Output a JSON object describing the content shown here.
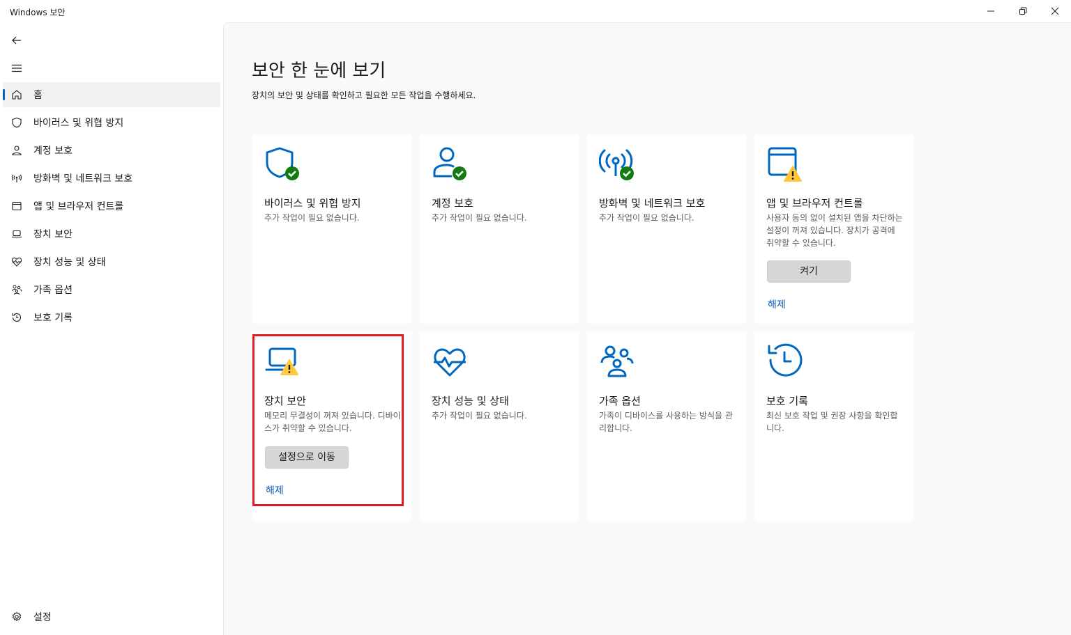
{
  "window": {
    "title": "Windows 보안",
    "minimize_glyph": "—",
    "maximize_glyph": "❐",
    "close_glyph": "✕"
  },
  "sidebar": {
    "items": [
      {
        "label": "홈",
        "icon": "home-icon",
        "active": true
      },
      {
        "label": "바이러스 및 위협 방지",
        "icon": "shield-icon"
      },
      {
        "label": "계정 보호",
        "icon": "person-icon"
      },
      {
        "label": "방화벽 및 네트워크 보호",
        "icon": "antenna-icon"
      },
      {
        "label": "앱 및 브라우저 컨트롤",
        "icon": "browser-window-icon"
      },
      {
        "label": "장치 보안",
        "icon": "laptop-icon"
      },
      {
        "label": "장치 성능 및 상태",
        "icon": "heart-pulse-icon"
      },
      {
        "label": "가족 옵션",
        "icon": "family-icon"
      },
      {
        "label": "보호 기록",
        "icon": "history-icon"
      }
    ],
    "settings_label": "설정"
  },
  "main": {
    "title": "보안 한 눈에 보기",
    "subtitle": "장치의 보안 및 상태를 확인하고 필요한 모든 작업을 수행하세요.",
    "cards": [
      {
        "title": "바이러스 및 위협 방지",
        "desc": "추가 작업이 필요 없습니다.",
        "icon": "shield-check-icon"
      },
      {
        "title": "계정 보호",
        "desc": "추가 작업이 필요 없습니다.",
        "icon": "person-check-icon"
      },
      {
        "title": "방화벽 및 네트워크 보호",
        "desc": "추가 작업이 필요 없습니다.",
        "icon": "antenna-check-icon"
      },
      {
        "title": "앱 및 브라우저 컨트롤",
        "desc": "사용자 동의 없이 설치된 앱을 차단하는 설정이 꺼져 있습니다. 장치가 공격에 취약할 수 있습니다.",
        "icon": "browser-warning-icon",
        "button": "켜기",
        "link": "해제"
      },
      {
        "title": "장치 보안",
        "desc": "메모리 무결성이 꺼져 있습니다. 디바이스가 취약할 수 있습니다.",
        "icon": "laptop-warning-icon",
        "button": "설정으로 이동",
        "link": "해제"
      },
      {
        "title": "장치 성능 및 상태",
        "desc": "추가 작업이 필요 없습니다.",
        "icon": "heart-pulse-icon"
      },
      {
        "title": "가족 옵션",
        "desc": "가족이 디바이스를 사용하는 방식을 관리합니다.",
        "icon": "family-icon"
      },
      {
        "title": "보호 기록",
        "desc": "최신 보호 작업 및 권장 사항을 확인합니다.",
        "icon": "history-icon"
      }
    ]
  },
  "colors": {
    "accent": "#0067c0",
    "ok_green": "#107c10",
    "warning_yellow": "#ffc83d",
    "highlight_red": "#e01b24"
  }
}
